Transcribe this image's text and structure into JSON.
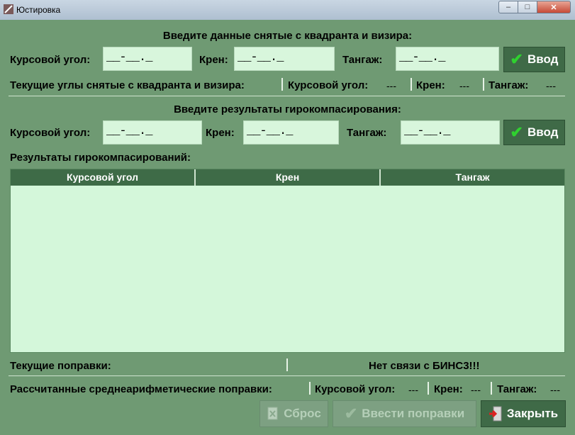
{
  "window": {
    "title": "Юстировка"
  },
  "section1": {
    "heading": "Введите данные снятые с квадранта и визира:",
    "course_label": "Курсовой угол:",
    "roll_label": "Крен:",
    "pitch_label": "Тангаж:",
    "course_value": "__-__._",
    "roll_value": "__-__._",
    "pitch_value": "__-__._",
    "enter_label": "Ввод"
  },
  "current_angles": {
    "label": "Текущие углы снятые с квадранта и визира:",
    "course_label": "Курсовой угол:",
    "course_value": "---",
    "roll_label": "Крен:",
    "roll_value": "---",
    "pitch_label": "Тангаж:",
    "pitch_value": "---"
  },
  "section2": {
    "heading": "Введите результаты гирокомпасирования:",
    "course_label": "Курсовой угол:",
    "roll_label": "Крен:",
    "pitch_label": "Тангаж:",
    "course_value": "__-__._",
    "roll_value": "__-__._",
    "pitch_value": "__-__._",
    "enter_label": "Ввод"
  },
  "results": {
    "label": "Результаты гирокомпасирований:",
    "columns": [
      "Курсовой угол",
      "Крен",
      "Тангаж"
    ]
  },
  "status": {
    "current_corrections_label": "Текущие поправки:",
    "connection_message": "Нет связи с БИНС3!!!"
  },
  "averages": {
    "label": "Рассчитанные среднеарифметические поправки:",
    "course_label": "Курсовой угол:",
    "course_value": "---",
    "roll_label": "Крен:",
    "roll_value": "---",
    "pitch_label": "Тангаж:",
    "pitch_value": "---"
  },
  "buttons": {
    "reset_label": "Сброс",
    "apply_label": "Ввести поправки",
    "close_label": "Закрыть"
  },
  "colors": {
    "background": "#6f9a73",
    "field": "#d8f6dc",
    "button": "#3f6a47",
    "header": "#3e6b47"
  }
}
